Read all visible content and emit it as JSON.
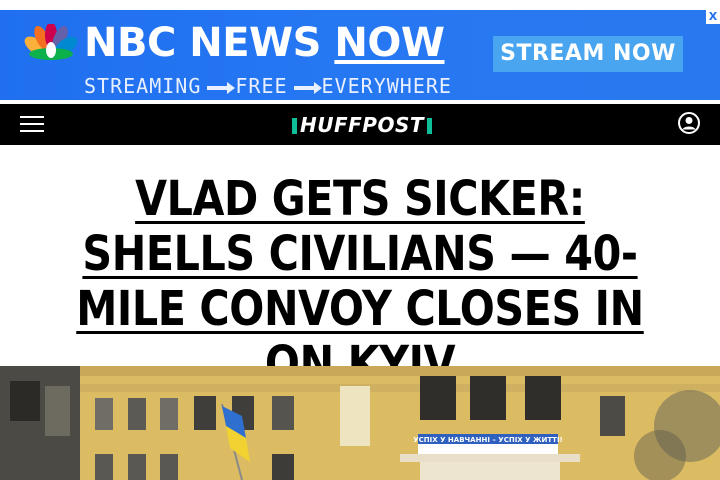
{
  "ad": {
    "brand_prefix": "NBC NEWS ",
    "brand_now": "NOW",
    "tagline_parts": [
      "STREAMING",
      "FREE",
      "EVERYWHERE"
    ],
    "cta_label": "STREAM NOW",
    "close_label": "X",
    "bg_color": "#2677f2"
  },
  "header": {
    "logo": "HUFFPOST",
    "accent_color": "#0dbe98",
    "menu_icon": "hamburger-menu-icon",
    "account_icon": "user-account-icon"
  },
  "article": {
    "headline": "VLAD GETS SICKER: SHELLS CIVILIANS — 40-MILE CONVOY CLOSES IN ON KYIV",
    "photo": {
      "banner_text_line1": "УСПІХ У НАВЧАННІ – УСПІХ У ЖИТТІ!"
    }
  }
}
